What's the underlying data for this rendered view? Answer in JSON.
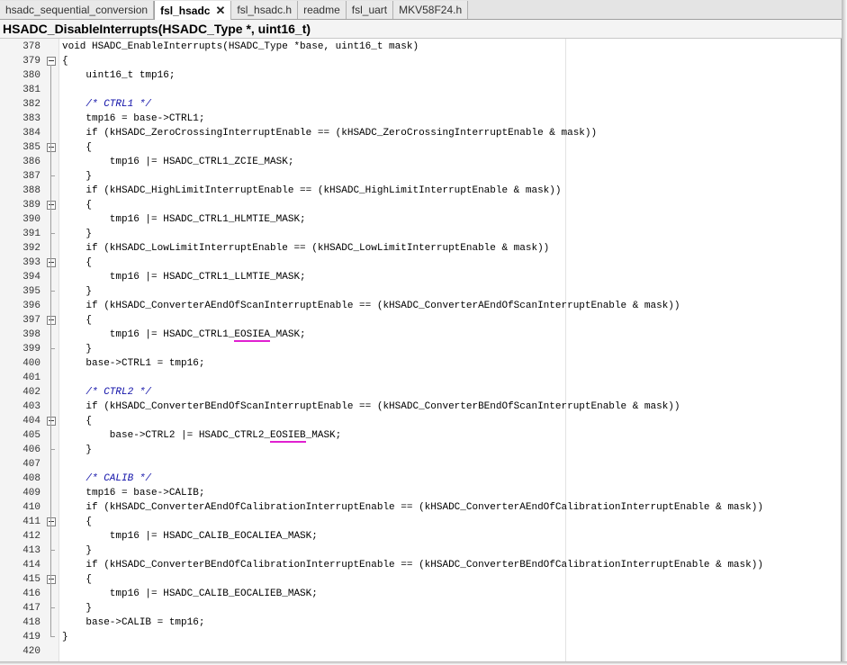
{
  "tabs": [
    {
      "label": "hsadc_sequential_conversion",
      "active": false
    },
    {
      "label": "fsl_hsadc",
      "active": true,
      "close_icon": "close-icon"
    },
    {
      "label": "fsl_hsadc.h",
      "active": false
    },
    {
      "label": "readme",
      "active": false
    },
    {
      "label": "fsl_uart",
      "active": false
    },
    {
      "label": "MKV58F24.h",
      "active": false
    }
  ],
  "function_bar": {
    "text": "HSADC_DisableInterrupts(HSADC_Type *, uint16_t)"
  },
  "colors": {
    "comment": "#1010a8",
    "highlight": "#e020d0",
    "gutter": "#f4f4f4"
  },
  "code_lines": [
    {
      "num": "378",
      "text": "void HSADC_EnableInterrupts(HSADC_Type *base, uint16_t mask)"
    },
    {
      "num": "379",
      "text": "{",
      "fold": "open"
    },
    {
      "num": "380",
      "text": "    uint16_t tmp16;"
    },
    {
      "num": "381",
      "text": ""
    },
    {
      "num": "382",
      "text": "    /* CTRL1 */",
      "comment": true
    },
    {
      "num": "383",
      "text": "    tmp16 = base->CTRL1;"
    },
    {
      "num": "384",
      "text": "    if (kHSADC_ZeroCrossingInterruptEnable == (kHSADC_ZeroCrossingInterruptEnable & mask))"
    },
    {
      "num": "385",
      "text": "    {",
      "fold": "open"
    },
    {
      "num": "386",
      "text": "        tmp16 |= HSADC_CTRL1_ZCIE_MASK;"
    },
    {
      "num": "387",
      "text": "    }",
      "fold": "end"
    },
    {
      "num": "388",
      "text": "    if (kHSADC_HighLimitInterruptEnable == (kHSADC_HighLimitInterruptEnable & mask))"
    },
    {
      "num": "389",
      "text": "    {",
      "fold": "open"
    },
    {
      "num": "390",
      "text": "        tmp16 |= HSADC_CTRL1_HLMTIE_MASK;"
    },
    {
      "num": "391",
      "text": "    }",
      "fold": "end"
    },
    {
      "num": "392",
      "text": "    if (kHSADC_LowLimitInterruptEnable == (kHSADC_LowLimitInterruptEnable & mask))"
    },
    {
      "num": "393",
      "text": "    {",
      "fold": "open"
    },
    {
      "num": "394",
      "text": "        tmp16 |= HSADC_CTRL1_LLMTIE_MASK;"
    },
    {
      "num": "395",
      "text": "    }",
      "fold": "end"
    },
    {
      "num": "396",
      "text": "    if (kHSADC_ConverterAEndOfScanInterruptEnable == (kHSADC_ConverterAEndOfScanInterruptEnable & mask))"
    },
    {
      "num": "397",
      "text": "    {",
      "fold": "open"
    },
    {
      "num": "398",
      "text": "        tmp16 |= HSADC_CTRL1_EOSIEA_MASK;",
      "highlight": "EOSIEA"
    },
    {
      "num": "399",
      "text": "    }",
      "fold": "end"
    },
    {
      "num": "400",
      "text": "    base->CTRL1 = tmp16;"
    },
    {
      "num": "401",
      "text": ""
    },
    {
      "num": "402",
      "text": "    /* CTRL2 */",
      "comment": true
    },
    {
      "num": "403",
      "text": "    if (kHSADC_ConverterBEndOfScanInterruptEnable == (kHSADC_ConverterBEndOfScanInterruptEnable & mask))"
    },
    {
      "num": "404",
      "text": "    {",
      "fold": "open"
    },
    {
      "num": "405",
      "text": "        base->CTRL2 |= HSADC_CTRL2_EOSIEB_MASK;",
      "highlight": "EOSIEB"
    },
    {
      "num": "406",
      "text": "    }",
      "fold": "end"
    },
    {
      "num": "407",
      "text": ""
    },
    {
      "num": "408",
      "text": "    /* CALIB */",
      "comment": true
    },
    {
      "num": "409",
      "text": "    tmp16 = base->CALIB;"
    },
    {
      "num": "410",
      "text": "    if (kHSADC_ConverterAEndOfCalibrationInterruptEnable == (kHSADC_ConverterAEndOfCalibrationInterruptEnable & mask))"
    },
    {
      "num": "411",
      "text": "    {",
      "fold": "open"
    },
    {
      "num": "412",
      "text": "        tmp16 |= HSADC_CALIB_EOCALIEA_MASK;"
    },
    {
      "num": "413",
      "text": "    }",
      "fold": "end"
    },
    {
      "num": "414",
      "text": "    if (kHSADC_ConverterBEndOfCalibrationInterruptEnable == (kHSADC_ConverterBEndOfCalibrationInterruptEnable & mask))"
    },
    {
      "num": "415",
      "text": "    {",
      "fold": "open"
    },
    {
      "num": "416",
      "text": "        tmp16 |= HSADC_CALIB_EOCALIEB_MASK;"
    },
    {
      "num": "417",
      "text": "    }",
      "fold": "end"
    },
    {
      "num": "418",
      "text": "    base->CALIB = tmp16;"
    },
    {
      "num": "419",
      "text": "}",
      "fold": "end"
    },
    {
      "num": "420",
      "text": ""
    }
  ]
}
